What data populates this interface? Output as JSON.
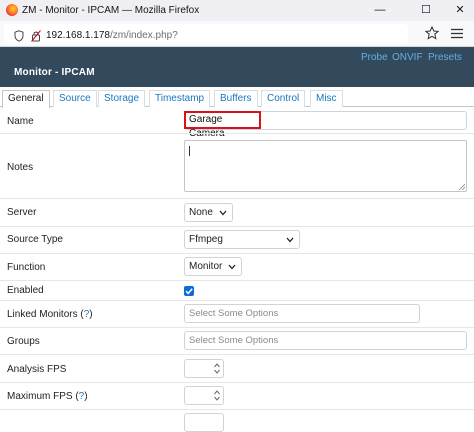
{
  "browser": {
    "window_title": "ZM - Monitor - IPCAM — Mozilla Firefox",
    "url_host": "192.168.1.178",
    "url_path": "/zm/index.php?",
    "controls": {
      "minimize": "—",
      "maximize": "☐",
      "close": "✕"
    }
  },
  "header": {
    "title": "Monitor - IPCAM",
    "links": [
      "Probe",
      "ONVIF",
      "Presets"
    ]
  },
  "tabs": [
    "General",
    "Source",
    "Storage",
    "Timestamp",
    "Buffers",
    "Control",
    "Misc"
  ],
  "active_tab": "General",
  "form": {
    "name_label": "Name",
    "name_value": "Garage Camera",
    "notes_label": "Notes",
    "server_label": "Server",
    "server_value": "None",
    "source_type_label": "Source Type",
    "source_type_value": "Ffmpeg",
    "function_label": "Function",
    "function_value": "Monitor",
    "enabled_label": "Enabled",
    "enabled_checked": true,
    "linked_monitors_label": "Linked Monitors (",
    "linked_monitors_help": "?",
    "linked_monitors_label_end": ")",
    "linked_monitors_placeholder": "Select Some Options",
    "groups_label": "Groups",
    "groups_placeholder": "Select Some Options",
    "analysis_fps_label": "Analysis FPS",
    "maximum_fps_label": "Maximum FPS (",
    "maximum_fps_help": "?",
    "maximum_fps_label_end": ")"
  },
  "colors": {
    "header_bg": "#33495c",
    "link": "#62b0e8",
    "highlight_border": "#d6141b",
    "checkbox": "#0b6cdb"
  }
}
